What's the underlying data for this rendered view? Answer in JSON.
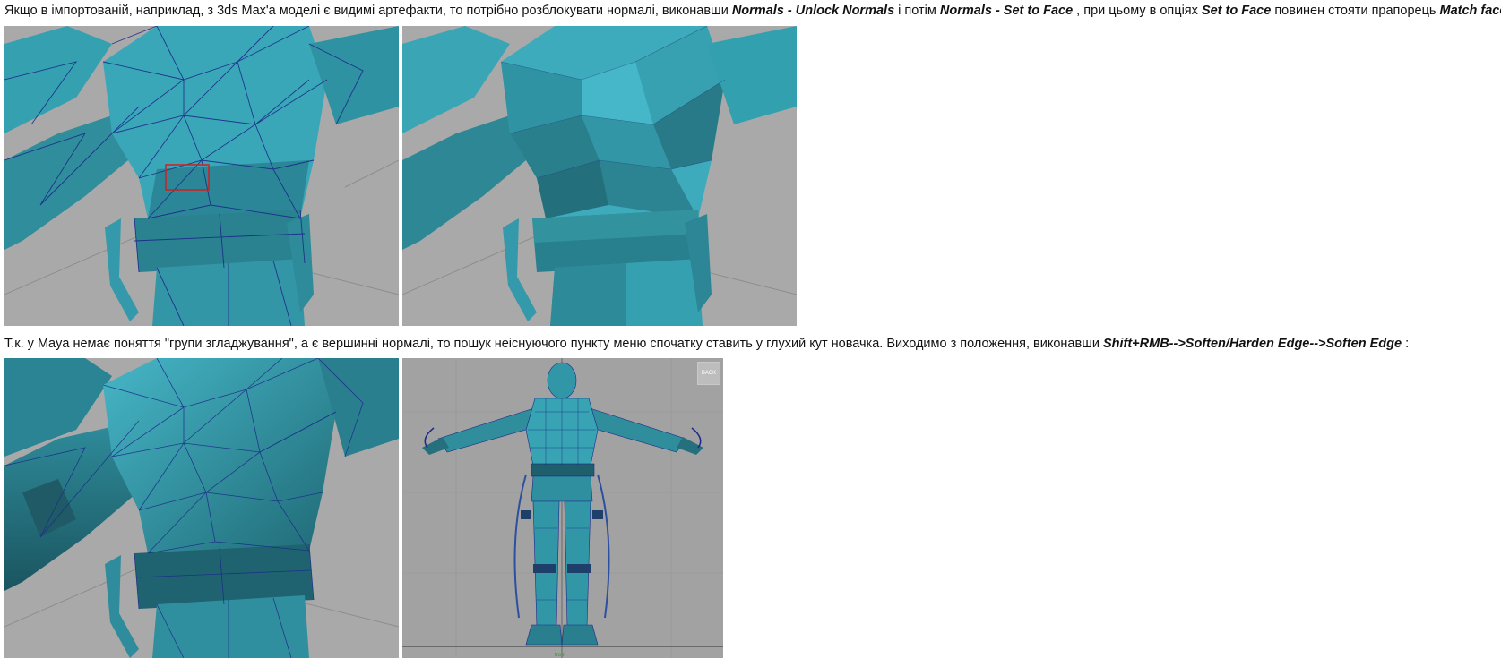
{
  "paragraph1": {
    "t1": "Якщо в імпортованій, наприклад, з 3ds Max'a моделі є видимі артефакти, то потрібно розблокувати нормалі, виконавши ",
    "b1": "Normals - Unlock Normals",
    "t2": " і потім ",
    "b2": "Normals - Set to Face",
    "t3": " , при цьому в опціях ",
    "b3": "Set to Face",
    "t4": " повинен стояти прапорець ",
    "b4": "Match face normal"
  },
  "paragraph2": {
    "t1": "Т.к. у Maya немає поняття \"групи згладжування\", а є вершинні нормалі, то пошук неіснуючого пункту меню спочатку ставить у глухий кут новачка. Виходимо з положення, виконавши ",
    "b1": "Shift+RMB-->Soften/Harden Edge-->Soften Edge",
    "t2": " :"
  },
  "viewport4": {
    "corner_button": "BACK",
    "view_label": "front"
  },
  "colors": {
    "mesh": "#3aa3b4",
    "mesh_dark": "#1f6e7c",
    "wire": "#1b2a8a",
    "viewport_bg": "#a8a8a8",
    "highlight_box": "#d11f1f"
  }
}
